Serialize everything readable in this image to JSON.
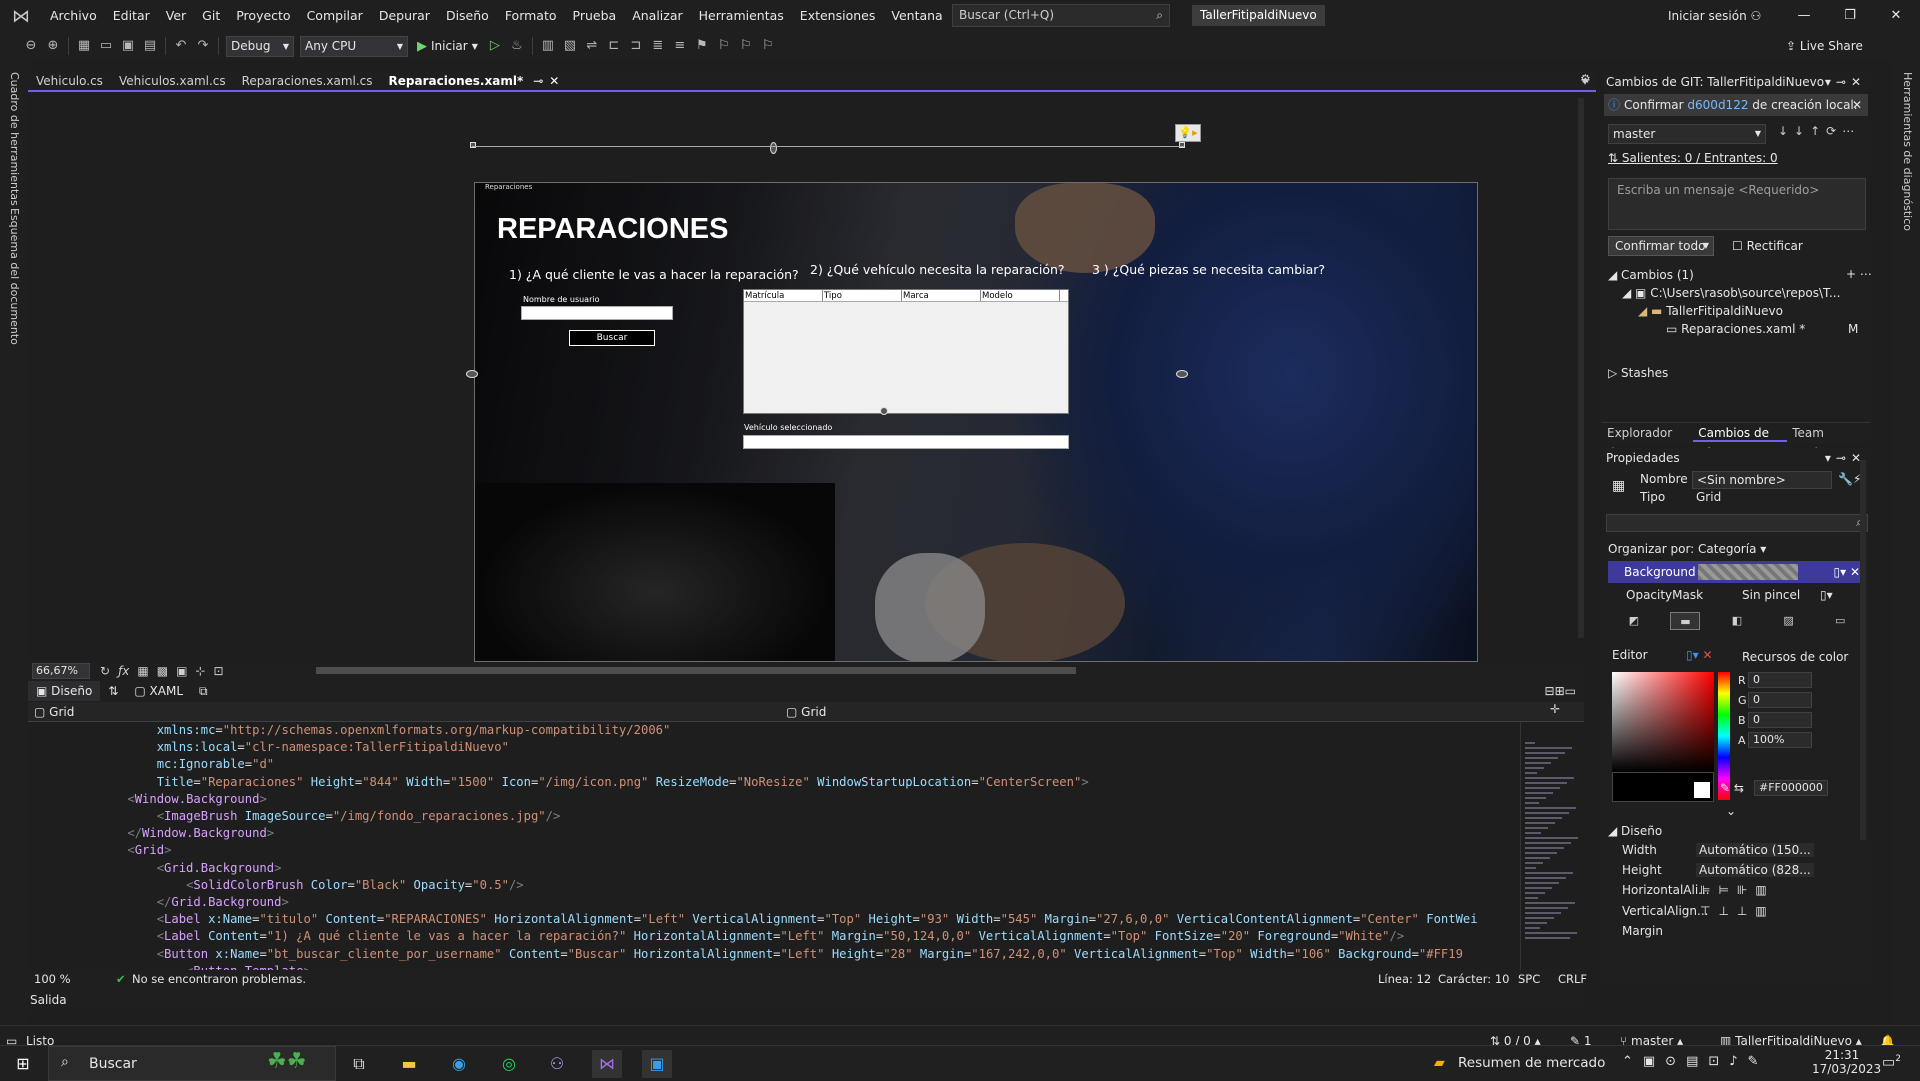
{
  "menu": [
    "Archivo",
    "Editar",
    "Ver",
    "Git",
    "Proyecto",
    "Compilar",
    "Depurar",
    "Diseño",
    "Formato",
    "Prueba",
    "Analizar",
    "Herramientas",
    "Extensiones",
    "Ventana",
    "Ayuda"
  ],
  "search": {
    "text": "Buscar (Ctrl+Q)"
  },
  "solution_name": "TallerFitipaldiNuevo",
  "signin": "Iniciar sesión",
  "toolbar": {
    "config": "Debug",
    "platform": "Any CPU",
    "start": "Iniciar",
    "live_share": "Live Share"
  },
  "side": {
    "left1": "Cuadro de herramientas",
    "left2": "Esquema del documento",
    "right1": "Herramientas de diagnóstico"
  },
  "tabs": [
    {
      "label": "Vehiculo.cs"
    },
    {
      "label": "Vehiculos.xaml.cs"
    },
    {
      "label": "Reparaciones.xaml.cs"
    },
    {
      "label": "Reparaciones.xaml*"
    }
  ],
  "canvas": {
    "window_label": "Reparaciones",
    "title": "REPARACIONES",
    "q1": "1) ¿A qué cliente le vas a hacer la reparación?",
    "q2": "2) ¿Qué vehículo necesita la reparación?",
    "q3": "3 ) ¿Qué piezas se necesita cambiar?",
    "user_label": "Nombre de usuario",
    "buscar": "Buscar",
    "columns": [
      "Matrícula",
      "Tipo",
      "Marca",
      "Modelo"
    ],
    "vehicle_selected": "Vehículo seleccionado"
  },
  "designer": {
    "zoom": "66,67%",
    "view_design": "Diseño",
    "view_xaml": "XAML",
    "nav_left": "Grid",
    "nav_right": "Grid"
  },
  "code_lines": [
    {
      "indent": "    ",
      "parts": [
        [
          "t-attr",
          "xmlns:mc"
        ],
        [
          "t-tag",
          "="
        ],
        [
          "t-val",
          "\"http://schemas.openxmlformats.org/markup-compatibility/2006\""
        ]
      ]
    },
    {
      "indent": "    ",
      "parts": [
        [
          "t-attr",
          "xmlns:local"
        ],
        [
          "t-tag",
          "="
        ],
        [
          "t-val",
          "\"clr-namespace:TallerFitipaldiNuevo\""
        ]
      ]
    },
    {
      "indent": "    ",
      "parts": [
        [
          "t-attr",
          "mc:Ignorable"
        ],
        [
          "t-tag",
          "="
        ],
        [
          "t-val",
          "\"d\""
        ]
      ]
    },
    {
      "indent": "    ",
      "parts": [
        [
          "t-attr",
          "Title"
        ],
        [
          "t-tag",
          "="
        ],
        [
          "t-val",
          "\"Reparaciones\""
        ],
        [
          "t-attr",
          " Height"
        ],
        [
          "t-tag",
          "="
        ],
        [
          "t-val",
          "\"844\""
        ],
        [
          "t-attr",
          " Width"
        ],
        [
          "t-tag",
          "="
        ],
        [
          "t-val",
          "\"1500\""
        ],
        [
          "t-attr",
          " Icon"
        ],
        [
          "t-tag",
          "="
        ],
        [
          "t-val",
          "\"/img/icon.png\""
        ],
        [
          "t-attr",
          " ResizeMode"
        ],
        [
          "t-tag",
          "="
        ],
        [
          "t-val",
          "\"NoResize\""
        ],
        [
          "t-attr",
          " WindowStartupLocation"
        ],
        [
          "t-tag",
          "="
        ],
        [
          "t-val",
          "\"CenterScreen\""
        ],
        [
          "t-b",
          ">"
        ]
      ]
    },
    {
      "indent": "",
      "parts": [
        [
          "t-b",
          "<"
        ],
        [
          "t-el",
          "Window.Background"
        ],
        [
          "t-b",
          ">"
        ]
      ]
    },
    {
      "indent": "    ",
      "parts": [
        [
          "t-b",
          "<"
        ],
        [
          "t-el",
          "ImageBrush"
        ],
        [
          "t-attr",
          " ImageSource"
        ],
        [
          "t-tag",
          "="
        ],
        [
          "t-val",
          "\"/img/fondo_reparaciones.jpg\""
        ],
        [
          "t-b",
          "/>"
        ]
      ]
    },
    {
      "indent": "",
      "parts": [
        [
          "t-b",
          "</"
        ],
        [
          "t-el",
          "Window.Background"
        ],
        [
          "t-b",
          ">"
        ]
      ]
    },
    {
      "indent": "",
      "parts": [
        [
          "t-b",
          "<"
        ],
        [
          "t-el",
          "Grid"
        ],
        [
          "t-b",
          ">"
        ]
      ]
    },
    {
      "indent": "    ",
      "parts": [
        [
          "t-b",
          "<"
        ],
        [
          "t-el",
          "Grid.Background"
        ],
        [
          "t-b",
          ">"
        ]
      ]
    },
    {
      "indent": "        ",
      "parts": [
        [
          "t-b",
          "<"
        ],
        [
          "t-el",
          "SolidColorBrush"
        ],
        [
          "t-attr",
          " Color"
        ],
        [
          "t-tag",
          "="
        ],
        [
          "t-val",
          "\"Black\""
        ],
        [
          "t-attr",
          " Opacity"
        ],
        [
          "t-tag",
          "="
        ],
        [
          "t-val",
          "\"0.5\""
        ],
        [
          "t-b",
          "/>"
        ]
      ]
    },
    {
      "indent": "    ",
      "parts": [
        [
          "t-b",
          "</"
        ],
        [
          "t-el",
          "Grid.Background"
        ],
        [
          "t-b",
          ">"
        ]
      ]
    },
    {
      "indent": "    ",
      "parts": [
        [
          "t-b",
          "<"
        ],
        [
          "t-el",
          "Label"
        ],
        [
          "t-attr",
          " x:Name"
        ],
        [
          "t-tag",
          "="
        ],
        [
          "t-val",
          "\"titulo\""
        ],
        [
          "t-attr",
          " Content"
        ],
        [
          "t-tag",
          "="
        ],
        [
          "t-val",
          "\"REPARACIONES\""
        ],
        [
          "t-attr",
          " HorizontalAlignment"
        ],
        [
          "t-tag",
          "="
        ],
        [
          "t-val",
          "\"Left\""
        ],
        [
          "t-attr",
          " VerticalAlignment"
        ],
        [
          "t-tag",
          "="
        ],
        [
          "t-val",
          "\"Top\""
        ],
        [
          "t-attr",
          " Height"
        ],
        [
          "t-tag",
          "="
        ],
        [
          "t-val",
          "\"93\""
        ],
        [
          "t-attr",
          " Width"
        ],
        [
          "t-tag",
          "="
        ],
        [
          "t-val",
          "\"545\""
        ],
        [
          "t-attr",
          " Margin"
        ],
        [
          "t-tag",
          "="
        ],
        [
          "t-val",
          "\"27,6,0,0\""
        ],
        [
          "t-attr",
          " VerticalContentAlignment"
        ],
        [
          "t-tag",
          "="
        ],
        [
          "t-val",
          "\"Center\""
        ],
        [
          "t-attr",
          " FontWei"
        ]
      ]
    },
    {
      "indent": "    ",
      "parts": [
        [
          "t-b",
          "<"
        ],
        [
          "t-el",
          "Label"
        ],
        [
          "t-attr",
          " Content"
        ],
        [
          "t-tag",
          "="
        ],
        [
          "t-val",
          "\"1) ¿A qué cliente le vas a hacer la reparación?\""
        ],
        [
          "t-attr",
          " HorizontalAlignment"
        ],
        [
          "t-tag",
          "="
        ],
        [
          "t-val",
          "\"Left\""
        ],
        [
          "t-attr",
          " Margin"
        ],
        [
          "t-tag",
          "="
        ],
        [
          "t-val",
          "\"50,124,0,0\""
        ],
        [
          "t-attr",
          " VerticalAlignment"
        ],
        [
          "t-tag",
          "="
        ],
        [
          "t-val",
          "\"Top\""
        ],
        [
          "t-attr",
          " FontSize"
        ],
        [
          "t-tag",
          "="
        ],
        [
          "t-val",
          "\"20\""
        ],
        [
          "t-attr",
          " Foreground"
        ],
        [
          "t-tag",
          "="
        ],
        [
          "t-val",
          "\"White\""
        ],
        [
          "t-b",
          "/>"
        ]
      ]
    },
    {
      "indent": "    ",
      "parts": [
        [
          "t-b",
          "<"
        ],
        [
          "t-el",
          "Button"
        ],
        [
          "t-attr",
          " x:Name"
        ],
        [
          "t-tag",
          "="
        ],
        [
          "t-val",
          "\"bt_buscar_cliente_por_username\""
        ],
        [
          "t-attr",
          " Content"
        ],
        [
          "t-tag",
          "="
        ],
        [
          "t-val",
          "\"Buscar\""
        ],
        [
          "t-attr",
          " HorizontalAlignment"
        ],
        [
          "t-tag",
          "="
        ],
        [
          "t-val",
          "\"Left\""
        ],
        [
          "t-attr",
          " Height"
        ],
        [
          "t-tag",
          "="
        ],
        [
          "t-val",
          "\"28\""
        ],
        [
          "t-attr",
          " Margin"
        ],
        [
          "t-tag",
          "="
        ],
        [
          "t-val",
          "\"167,242,0,0\""
        ],
        [
          "t-attr",
          " VerticalAlignment"
        ],
        [
          "t-tag",
          "="
        ],
        [
          "t-val",
          "\"Top\""
        ],
        [
          "t-attr",
          " Width"
        ],
        [
          "t-tag",
          "="
        ],
        [
          "t-val",
          "\"106\""
        ],
        [
          "t-attr",
          " Background"
        ],
        [
          "t-tag",
          "="
        ],
        [
          "t-val",
          "\"#FF19"
        ]
      ]
    },
    {
      "indent": "        ",
      "parts": [
        [
          "t-b",
          "<"
        ],
        [
          "t-el",
          "Button.Template"
        ],
        [
          "t-b",
          ">"
        ]
      ]
    }
  ],
  "code_status": {
    "zoom": "100 %",
    "problems": "No se encontraron problemas.",
    "line": "Línea: 12",
    "char": "Carácter: 10",
    "spc": "SPC",
    "crlf": "CRLF"
  },
  "output_label": "Salida",
  "git": {
    "title": "Cambios de GIT: TallerFitipaldiNuevo",
    "info_prefix": "Confirmar",
    "info_commit": "d600d122",
    "info_suffix": "de creación local.",
    "branch": "master",
    "salientes": "Salientes: 0 / Entrantes: 0",
    "message_placeholder": "Escriba un mensaje <Requerido>",
    "confirm_all": "Confirmar todo",
    "rectificar": "Rectificar",
    "changes": "Cambios (1)",
    "path": "C:\\Users\\rasob\\source\\repos\\T...",
    "project": "TallerFitipaldiNuevo",
    "file": "Reparaciones.xaml *",
    "file_status": "M",
    "stashes": "Stashes",
    "tabs": [
      "Explorador de...",
      "Cambios de Gl...",
      "Team Explorer"
    ]
  },
  "props": {
    "title": "Propiedades",
    "name_label": "Nombre",
    "name_value": "<Sin nombre>",
    "type_label": "Tipo",
    "type_value": "Grid",
    "organize": "Organizar por: Categoría",
    "background": "Background",
    "opacity_mask": "OpacityMask",
    "no_brush": "Sin pincel",
    "editor": "Editor",
    "color_resources": "Recursos de color",
    "r": "0",
    "g": "0",
    "b": "0",
    "a": "100%",
    "hex": "#FF000000",
    "section_design": "Diseño",
    "width_label": "Width",
    "width_value": "Automático (150...",
    "height_label": "Height",
    "height_value": "Automático (828...",
    "halign_label": "HorizontalAli...",
    "valign_label": "VerticalAlign...",
    "margin_label": "Margin"
  },
  "status": {
    "ready": "Listo",
    "sync": "0 / 0",
    "edits": "1",
    "branch": "master",
    "repo": "TallerFitipaldiNuevo"
  },
  "taskbar": {
    "search": "Buscar",
    "widget": "Resumen de mercado",
    "time": "21:31",
    "date": "17/03/2023",
    "notif": "2"
  }
}
